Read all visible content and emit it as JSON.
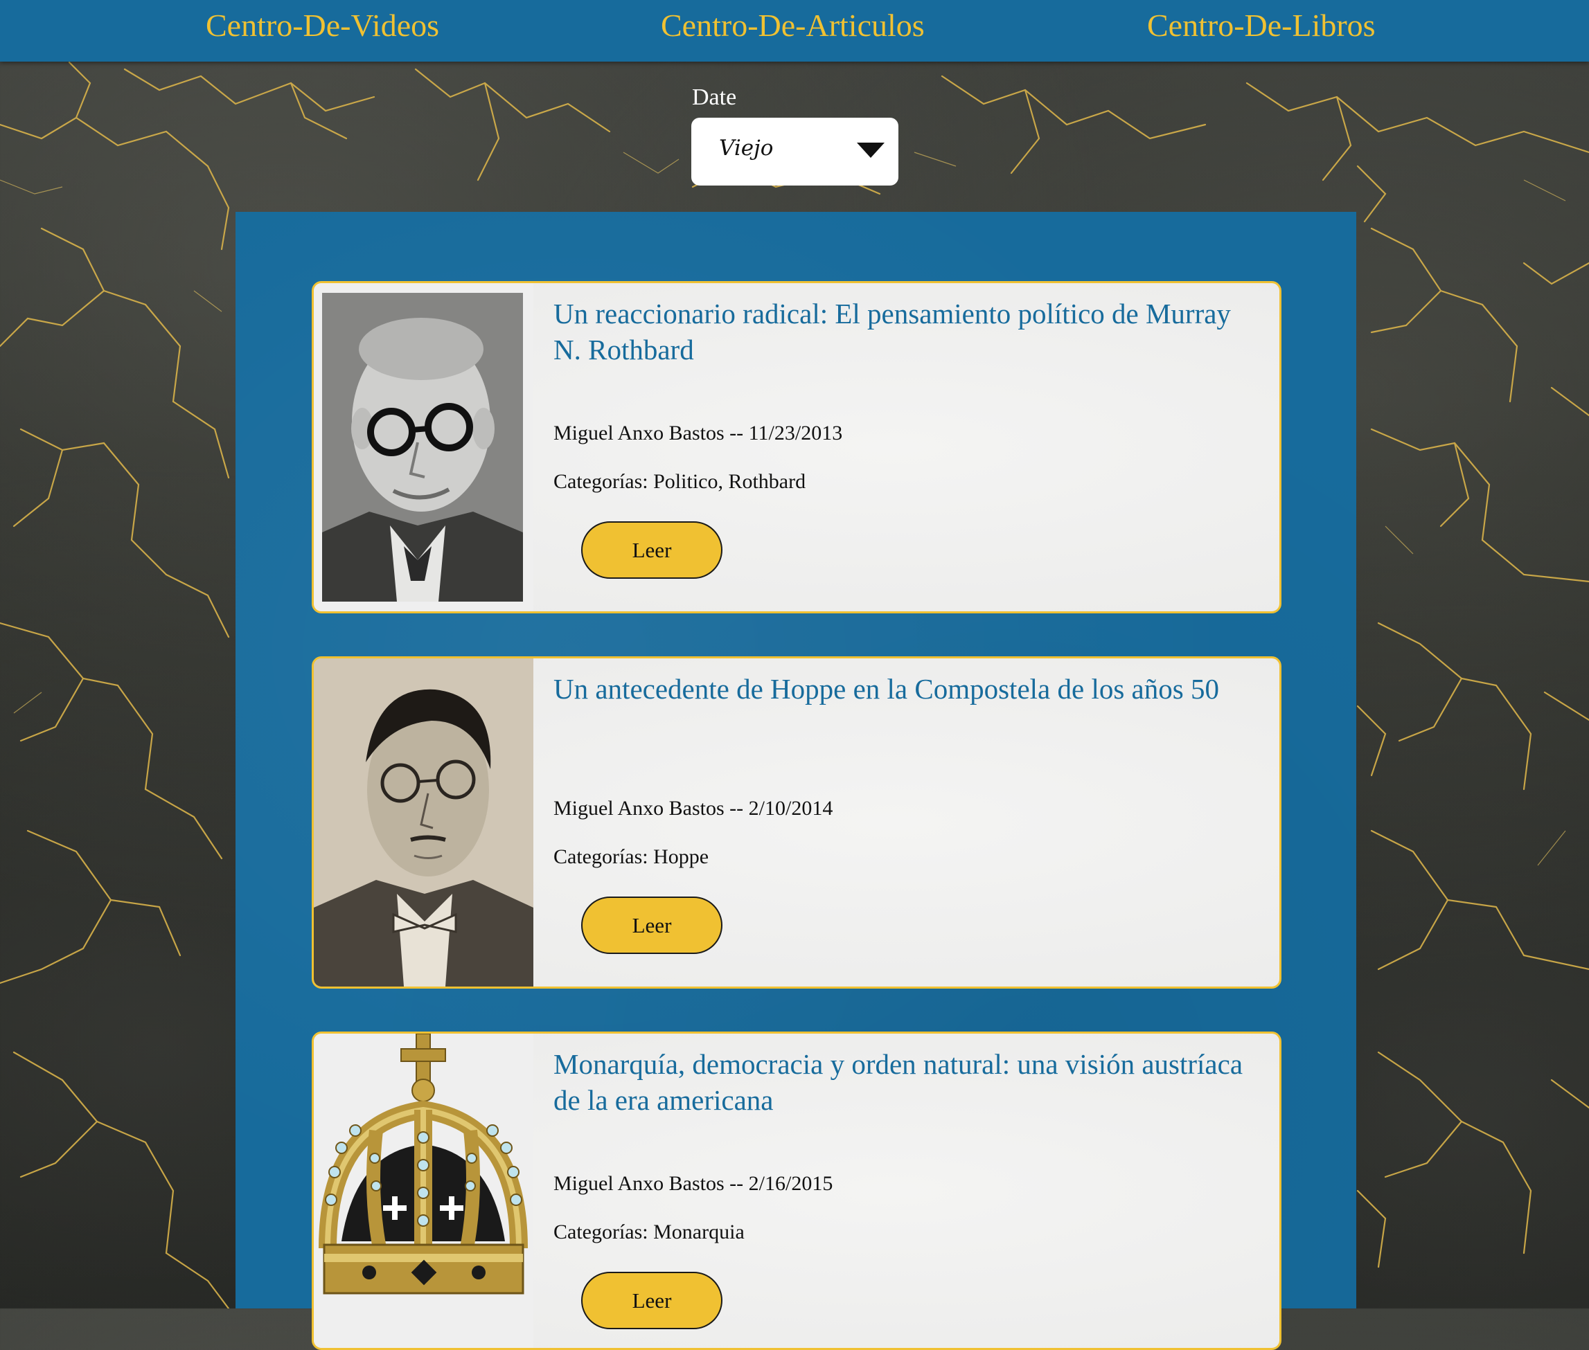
{
  "nav": {
    "videos": "Centro-De-Videos",
    "articulos": "Centro-De-Articulos",
    "libros": "Centro-De-Libros"
  },
  "filter": {
    "label": "Date",
    "selected": "Viejo"
  },
  "articles": [
    {
      "title": "Un reaccionario radical: El pensamiento político de Murray N. Rothbard",
      "meta": "Miguel Anxo Bastos -- 11/23/2013",
      "categories": "Categorías: Politico, Rothbard",
      "button": "Leer",
      "image_icon": "portrait-photo"
    },
    {
      "title": "Un antecedente de Hoppe en la Compostela de los años 50",
      "meta": "Miguel Anxo Bastos -- 2/10/2014",
      "categories": "Categorías: Hoppe",
      "button": "Leer",
      "image_icon": "portrait-drawing"
    },
    {
      "title": "Monarquía, democracia y orden natural: una visión austríaca de la era americana",
      "meta": "Miguel Anxo Bastos -- 2/16/2015",
      "categories": "Categorías: Monarquia",
      "button": "Leer",
      "image_icon": "crown-icon"
    }
  ],
  "colors": {
    "nav_bg": "#176b9c",
    "accent_gold": "#f0c132",
    "title_blue": "#176b9c",
    "card_bg": "#efefef"
  }
}
